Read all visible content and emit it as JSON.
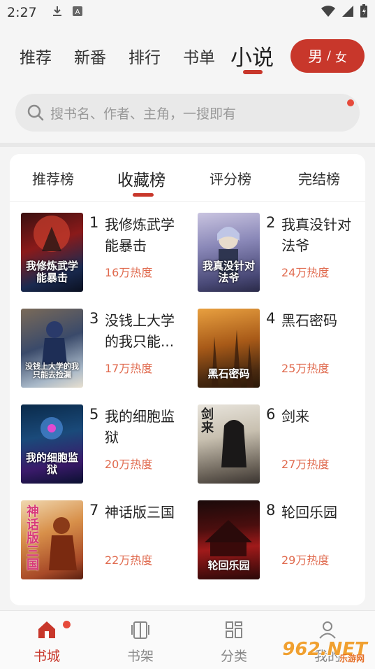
{
  "status_bar": {
    "time": "2:27",
    "icons": [
      "download-icon",
      "a-icon",
      "wifi-icon",
      "battery-icon"
    ]
  },
  "top_nav": {
    "items": [
      "推荐",
      "新番",
      "排行",
      "书单",
      "小说"
    ],
    "active": "小说",
    "gender": {
      "male": "男",
      "sep": "/",
      "female": "女"
    }
  },
  "search": {
    "placeholder": "搜书名、作者、主角，一搜即有"
  },
  "tabs": {
    "items": [
      "推荐榜",
      "收藏榜",
      "评分榜",
      "完结榜"
    ],
    "active": "收藏榜"
  },
  "books": [
    {
      "rank": "1",
      "title": "我修炼武学能暴击",
      "heat": "16万热度",
      "cover_text": "我修炼武学能暴击"
    },
    {
      "rank": "2",
      "title": "我真没针对法爷",
      "heat": "24万热度",
      "cover_text": "我真没针对法爷"
    },
    {
      "rank": "3",
      "title": "没钱上大学的我只能...",
      "heat": "17万热度",
      "cover_text": "没钱上大学的我只能去捡漏"
    },
    {
      "rank": "4",
      "title": "黑石密码",
      "heat": "25万热度",
      "cover_text": "黑石密码"
    },
    {
      "rank": "5",
      "title": "我的细胞监狱",
      "heat": "20万热度",
      "cover_text": "我的细胞监狱"
    },
    {
      "rank": "6",
      "title": "剑来",
      "heat": "27万热度",
      "cover_text": "剑来"
    },
    {
      "rank": "7",
      "title": "神话版三国",
      "heat": "22万热度",
      "cover_text": "神话版三国"
    },
    {
      "rank": "8",
      "title": "轮回乐园",
      "heat": "29万热度",
      "cover_text": "轮回乐园"
    }
  ],
  "bottom_nav": {
    "items": [
      "书城",
      "书架",
      "分类",
      "我的"
    ],
    "active": "书城"
  },
  "watermark": {
    "text": "962.NET",
    "sub": "乐游网"
  },
  "colors": {
    "accent": "#c8372b",
    "heat": "#e06a4e",
    "badge": "#e64a3b"
  }
}
